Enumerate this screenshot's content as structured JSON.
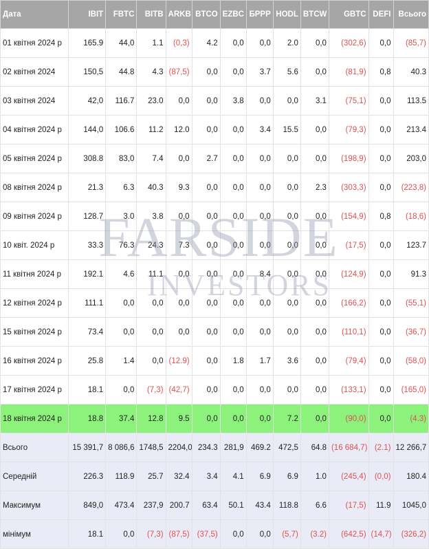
{
  "headers": [
    "Дата",
    "IBIT",
    "FBTC",
    "BITB",
    "ARKB",
    "BTCO",
    "EZBC",
    "БРРР",
    "HODL",
    "BTCW",
    "GBTC",
    "DEFI",
    "Всього"
  ],
  "rows": [
    [
      "01 квітня 2024 р",
      "165.9",
      "44,0",
      "1.1",
      "(0,3)",
      "4.2",
      "0,0",
      "0,0",
      "2.0",
      "0,0",
      "(302,6)",
      "0,0",
      "(85,7)"
    ],
    [
      "02 квітня 2024",
      "150,5",
      "44.8",
      "4.3",
      "(87,5)",
      "0,0",
      "0,0",
      "3.7",
      "5.6",
      "0,0",
      "(81,9)",
      "0,8",
      "40.3"
    ],
    [
      "03 квітня 2024",
      "42,0",
      "116.7",
      "23.0",
      "0,0",
      "0,0",
      "3.8",
      "0,0",
      "0,0",
      "3.1",
      "(75,1)",
      "0,0",
      "113.5"
    ],
    [
      "04 квітня 2024 р",
      "144,0",
      "106.6",
      "11.2",
      "12.0",
      "0,0",
      "0,0",
      "3.4",
      "15.5",
      "0,0",
      "(79,3)",
      "0,0",
      "213.4"
    ],
    [
      "05 квітня 2024 р",
      "308.8",
      "83,0",
      "7.4",
      "0,0",
      "2.7",
      "0,0",
      "0,0",
      "0,0",
      "0,0",
      "(198,9)",
      "0,0",
      "203,0"
    ],
    [
      "08 квітня 2024 р",
      "21.3",
      "6.3",
      "40.3",
      "9.3",
      "0,0",
      "0,0",
      "0,0",
      "0,0",
      "2.3",
      "(303,3)",
      "0,0",
      "(223,8)"
    ],
    [
      "09 квітня 2024 р",
      "128.7",
      "3.0",
      "3.8",
      "0,0",
      "0,0",
      "0,0",
      "0,0",
      "0,0",
      "0,0",
      "(154,9)",
      "0,8",
      "(18,6)"
    ],
    [
      "10 квіт. 2024 р",
      "33.3",
      "76.3",
      "24.3",
      "7.3",
      "0,0",
      "0,0",
      "0,0",
      "0,0",
      "0,0",
      "(17,5)",
      "0,0",
      "123.7"
    ],
    [
      "11 квітня 2024 р",
      "192.1",
      "4.6",
      "11.1",
      "0,0",
      "0,0",
      "0,0",
      "8.4",
      "0,0",
      "0,0",
      "(124,9)",
      "0,0",
      "91.3"
    ],
    [
      "12 квітня 2024 р",
      "111.1",
      "0,0",
      "0,0",
      "0,0",
      "0,0",
      "0,0",
      "0,0",
      "0,0",
      "0,0",
      "(166,2)",
      "0,0",
      "(55,1)"
    ],
    [
      "15 квітня 2024 р",
      "73.4",
      "0,0",
      "0,0",
      "0,0",
      "0,0",
      "0,0",
      "0,0",
      "0,0",
      "0,0",
      "(110,1)",
      "0,0",
      "(36,7)"
    ],
    [
      "16 квітня 2024 р",
      "25.8",
      "1.4",
      "0,0",
      "(12.9)",
      "0,0",
      "1.8",
      "1.7",
      "3.6",
      "0,0",
      "(79,4)",
      "0,0",
      "(58,0)"
    ],
    [
      "17 квітня 2024 р",
      "18.1",
      "0,0",
      "(7,3)",
      "(42,7)",
      "0,0",
      "0,0",
      "0,0",
      "0,0",
      "0,0",
      "(133,1)",
      "0,0",
      "(165,0)"
    ],
    [
      "18 квітня 2024 р",
      "18.8",
      "37.4",
      "12.8",
      "9.5",
      "0,0",
      "0,0",
      "0,0",
      "7.2",
      "0,0",
      "(90,0)",
      "0,0",
      "(4.3)"
    ],
    [
      "Всього",
      "15 391,7",
      "8 086,6",
      "1748,5",
      "2204,0",
      "234.3",
      "281,9",
      "469.2",
      "472,5",
      "64.8",
      "(16 684,7)",
      "(2.1)",
      "12 266,7"
    ],
    [
      "Середній",
      "226.3",
      "118.9",
      "25.7",
      "32.4",
      "3.4",
      "4.1",
      "6.9",
      "6.9",
      "1.0",
      "(245,4)",
      "(0,0)",
      "180.4"
    ],
    [
      "Максимум",
      "849,0",
      "473.4",
      "237,9",
      "200.7",
      "63.4",
      "50.1",
      "43.4",
      "118.8",
      "6.6",
      "(17,5)",
      "11.9",
      "1045,0"
    ],
    [
      "мінімум",
      "18.1",
      "0,0",
      "(7,3)",
      "(87,5)",
      "(37,5)",
      "0,0",
      "0,0",
      "(5,7)",
      "(3.2)",
      "(642,5)",
      "(14,7)",
      "(326,2)"
    ]
  ],
  "highlight_row": 13,
  "summary_start": 14,
  "colors": {
    "header_bg": "#a6a6a6",
    "highlight": "#8df27b",
    "summary_bg": "#e9ecf6",
    "negative": "#e05050"
  },
  "watermark": {
    "line1": "FARSIDE",
    "line2": "INVESTORS"
  }
}
